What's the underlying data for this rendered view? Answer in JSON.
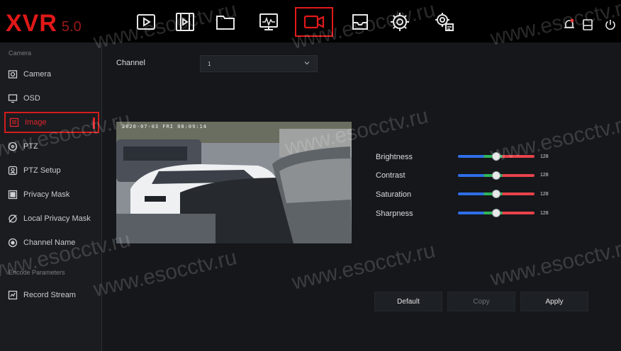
{
  "app": {
    "logo_main": "XVR",
    "logo_version": "5.0"
  },
  "topnav": [
    {
      "name": "playback-icon"
    },
    {
      "name": "video-clip-icon"
    },
    {
      "name": "folder-icon"
    },
    {
      "name": "monitor-icon"
    },
    {
      "name": "camera-icon",
      "active": true
    },
    {
      "name": "inbox-icon"
    },
    {
      "name": "gear-icon"
    },
    {
      "name": "advanced-settings-icon"
    }
  ],
  "sidebar": {
    "section_camera": "Camera",
    "items": [
      {
        "label": "Camera"
      },
      {
        "label": "OSD"
      },
      {
        "label": "Image"
      },
      {
        "label": "PTZ"
      },
      {
        "label": "PTZ Setup"
      },
      {
        "label": "Privacy Mask"
      },
      {
        "label": "Local Privacy Mask"
      },
      {
        "label": "Channel Name"
      }
    ],
    "section_encode": "Encode Parameters",
    "encode_items": [
      {
        "label": "Record Stream"
      }
    ]
  },
  "main": {
    "channel_label": "Channel",
    "channel_value": "1",
    "preview_timestamp": "2020-07-03 FRI 08:09:14",
    "sliders": [
      {
        "label": "Brightness",
        "value": "128",
        "level": 0.5
      },
      {
        "label": "Contrast",
        "value": "128",
        "level": 0.5
      },
      {
        "label": "Saturation",
        "value": "128",
        "level": 0.5
      },
      {
        "label": "Sharpness",
        "value": "128",
        "level": 0.5
      }
    ],
    "buttons": {
      "default": "Default",
      "copy": "Copy",
      "apply": "Apply"
    }
  },
  "watermark": "www.esocctv.ru",
  "colors": {
    "accent": "#e01818",
    "slider_blue": "#2f6fe8",
    "slider_green": "#2fb65a",
    "slider_red": "#e8434b"
  }
}
